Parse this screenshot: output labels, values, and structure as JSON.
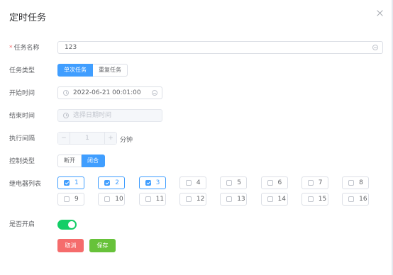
{
  "dialog": {
    "title": "定时任务"
  },
  "form": {
    "task_name": {
      "label": "任务名称",
      "required_mark": "*",
      "value": "123"
    },
    "task_type": {
      "label": "任务类型",
      "options": [
        "单次任务",
        "重复任务"
      ],
      "selected": "单次任务"
    },
    "start_time": {
      "label": "开始时间",
      "value": "2022-06-21 00:01:00"
    },
    "end_time": {
      "label": "结束时间",
      "placeholder": "选择日期时间"
    },
    "interval": {
      "label": "执行间隔",
      "value": "1",
      "unit": "分钟",
      "dec": "−",
      "inc": "+"
    },
    "control_type": {
      "label": "控制类型",
      "options": [
        "断开",
        "闭合"
      ],
      "selected": "闭合"
    },
    "relays": {
      "label": "继电器列表",
      "items": [
        {
          "n": "1",
          "checked": true
        },
        {
          "n": "2",
          "checked": true
        },
        {
          "n": "3",
          "checked": true
        },
        {
          "n": "4",
          "checked": false
        },
        {
          "n": "5",
          "checked": false
        },
        {
          "n": "6",
          "checked": false
        },
        {
          "n": "7",
          "checked": false
        },
        {
          "n": "8",
          "checked": false
        },
        {
          "n": "9",
          "checked": false
        },
        {
          "n": "10",
          "checked": false
        },
        {
          "n": "11",
          "checked": false
        },
        {
          "n": "12",
          "checked": false
        },
        {
          "n": "13",
          "checked": false
        },
        {
          "n": "14",
          "checked": false
        },
        {
          "n": "15",
          "checked": false
        },
        {
          "n": "16",
          "checked": false
        }
      ]
    },
    "enabled": {
      "label": "是否开启",
      "on": true
    }
  },
  "actions": {
    "cancel": "取消",
    "save": "保存"
  },
  "colors": {
    "primary": "#409eff",
    "switch_on": "#13ce66",
    "cancel": "#f56c6c",
    "save": "#67c23a"
  }
}
